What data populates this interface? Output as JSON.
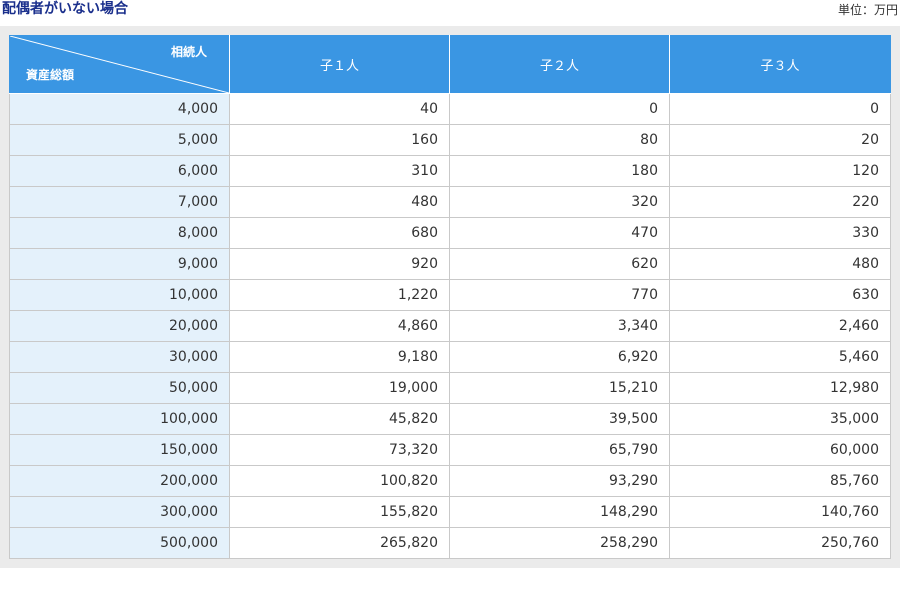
{
  "header": {
    "title": "配偶者がいない場合",
    "unit": "単位：万円"
  },
  "table": {
    "corner": {
      "column_axis_label": "相続人",
      "row_axis_label": "資産総額"
    },
    "columns": [
      "子１人",
      "子２人",
      "子３人"
    ],
    "rows": [
      {
        "asset": "4,000",
        "values": [
          "40",
          "0",
          "0"
        ]
      },
      {
        "asset": "5,000",
        "values": [
          "160",
          "80",
          "20"
        ]
      },
      {
        "asset": "6,000",
        "values": [
          "310",
          "180",
          "120"
        ]
      },
      {
        "asset": "7,000",
        "values": [
          "480",
          "320",
          "220"
        ]
      },
      {
        "asset": "8,000",
        "values": [
          "680",
          "470",
          "330"
        ]
      },
      {
        "asset": "9,000",
        "values": [
          "920",
          "620",
          "480"
        ]
      },
      {
        "asset": "10,000",
        "values": [
          "1,220",
          "770",
          "630"
        ]
      },
      {
        "asset": "20,000",
        "values": [
          "4,860",
          "3,340",
          "2,460"
        ]
      },
      {
        "asset": "30,000",
        "values": [
          "9,180",
          "6,920",
          "5,460"
        ]
      },
      {
        "asset": "50,000",
        "values": [
          "19,000",
          "15,210",
          "12,980"
        ]
      },
      {
        "asset": "100,000",
        "values": [
          "45,820",
          "39,500",
          "35,000"
        ]
      },
      {
        "asset": "150,000",
        "values": [
          "73,320",
          "65,790",
          "60,000"
        ]
      },
      {
        "asset": "200,000",
        "values": [
          "100,820",
          "93,290",
          "85,760"
        ]
      },
      {
        "asset": "300,000",
        "values": [
          "155,820",
          "148,290",
          "140,760"
        ]
      },
      {
        "asset": "500,000",
        "values": [
          "265,820",
          "258,290",
          "250,760"
        ]
      }
    ]
  },
  "colors": {
    "title": "#1a2f8c",
    "header_bg": "#3a96e3",
    "row_head_bg": "#e4f1fb",
    "panel_bg": "#ebebeb"
  }
}
